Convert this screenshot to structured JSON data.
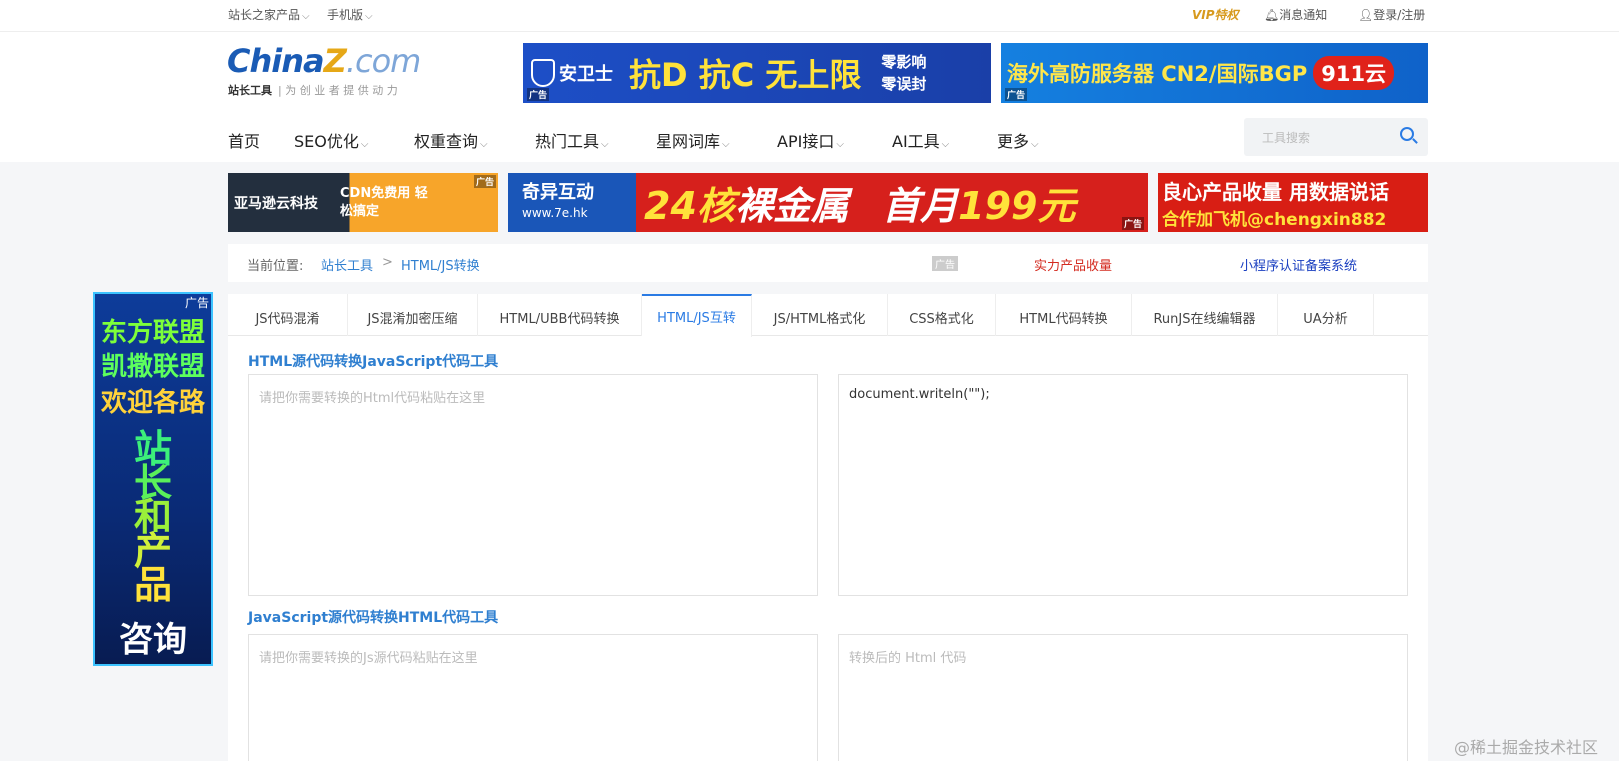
{
  "topbar": {
    "products": "站长之家产品",
    "mobile": "手机版",
    "vip": "VIP特权",
    "notice": "消息通知",
    "login": "登录/注册"
  },
  "logo": {
    "china": "China",
    "z": "Z",
    "com": ".com",
    "tool": "站长工具",
    "slogan": "为 创 业 者 提 供 动 力"
  },
  "banners": {
    "top1_brand": "安卫士",
    "top1_main": "抗D 抗C 无上限",
    "top1_side1": "零影响",
    "top1_side2": "零误封",
    "top2_main": "海外高防服务器 CN2/国际BGP",
    "top2_badge": "911云",
    "ad_tag": "广告",
    "mid1_brand": "亚马逊云科技",
    "mid1_text": "CDN免费用 轻松搞定",
    "mid2_brand": "奇异互动",
    "mid2_url": "www.7e.hk",
    "mid2_main1": "24核",
    "mid2_main2": "裸金属",
    "mid2_main3": "首月",
    "mid2_main4": "199元",
    "mid3_line1": "良心产品收量 用数据说话",
    "mid3_line2": "合作加飞机@chengxin882"
  },
  "nav": {
    "items": [
      "首页",
      "SEO优化",
      "权重查询",
      "热门工具",
      "星网词库",
      "API接口",
      "AI工具",
      "更多"
    ],
    "search_placeholder": "工具搜索"
  },
  "breadcrumb": {
    "label": "当前位置:",
    "home": "站长工具",
    "sep": ">",
    "current": "HTML/JS转换",
    "ad": "广告",
    "link_red": "实力产品收量",
    "link_blue": "小程序认证备案系统"
  },
  "side_ad": {
    "tag": "广告",
    "line1": "东方联盟",
    "line2": "凯撒联盟",
    "line3": "欢迎各路",
    "big": [
      "站",
      "长",
      "和",
      "产",
      "品"
    ],
    "bottom": "咨询"
  },
  "tabs": [
    "JS代码混淆",
    "JS混淆加密压缩",
    "HTML/UBB代码转换",
    "HTML/JS互转",
    "JS/HTML格式化",
    "CSS格式化",
    "HTML代码转换",
    "RunJS在线编辑器",
    "UA分析"
  ],
  "section1": {
    "title": "HTML源代码转换JavaScript代码工具",
    "input_placeholder": "请把你需要转换的Html代码粘贴在这里",
    "output_value": "document.writeln(\"\");"
  },
  "section2": {
    "title": "JavaScript源代码转换HTML代码工具",
    "input_placeholder": "请把你需要转换的Js源代码粘贴在这里",
    "output_placeholder": "转换后的 Html 代码"
  },
  "watermark": "@稀土掘金技术社区",
  "colors": {
    "accent": "#2a7be4",
    "brand": "#1a5bb5",
    "ad_red": "#d42a1f"
  }
}
